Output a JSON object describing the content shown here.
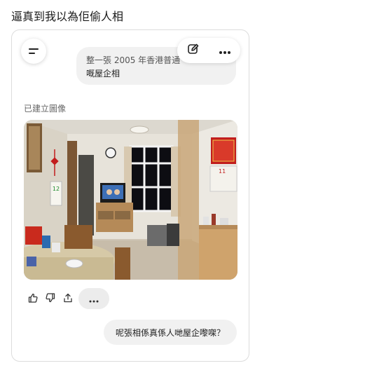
{
  "post": {
    "text": "逼真到我以為佢偷人相"
  },
  "chat": {
    "prompt_line1": "整一張 2005 年香港普通",
    "prompt_line2": "嘅屋企相",
    "created_label": "已建立圖像",
    "question": "呢張相係真係人哋屋企嚟㗎？"
  },
  "photo": {
    "calendar_number": "12",
    "calendar_month": "11"
  },
  "icons": {
    "menu": "menu-icon",
    "edit": "edit-icon",
    "more": "more-horizontal-icon",
    "like": "thumbs-up-icon",
    "dislike": "thumbs-down-icon",
    "share": "share-icon"
  },
  "colors": {
    "bubble": "#f1f1f1",
    "card_border": "#dcdcdc",
    "wall": "#e9e6df",
    "floor": "#c7bcaa"
  }
}
